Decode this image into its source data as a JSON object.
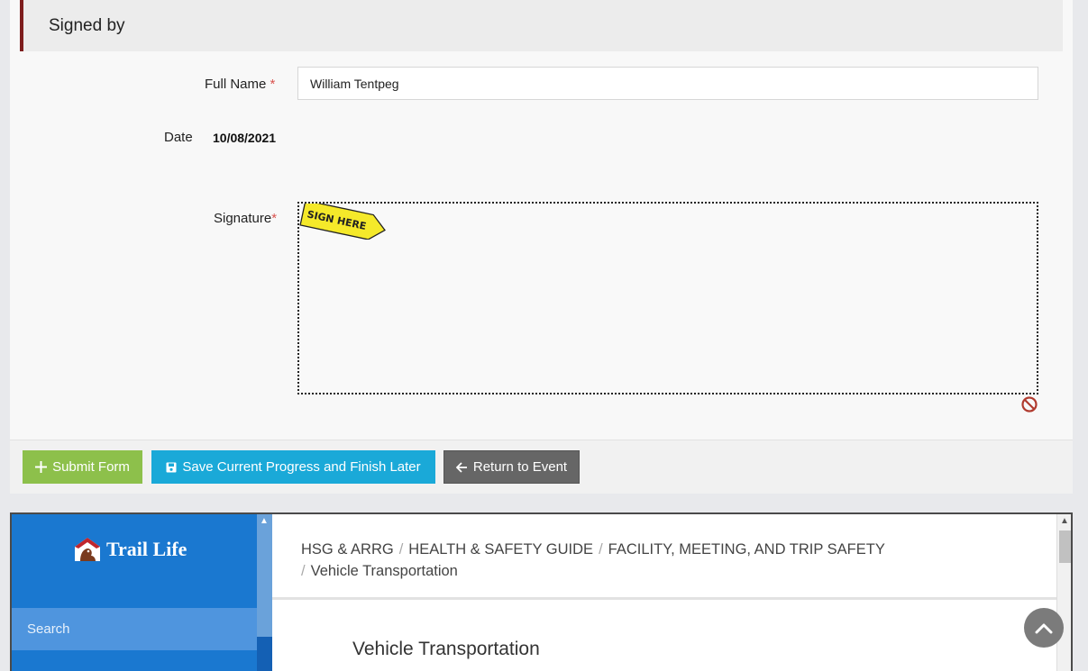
{
  "section": {
    "title": "Signed by"
  },
  "form": {
    "full_name_label": "Full Name",
    "required_mark": "*",
    "full_name_value": "William Tentpeg",
    "date_label": "Date",
    "date_value": "10/08/2021",
    "signature_label": "Signature",
    "sign_here_text": "SIGN HERE",
    "clear_icon": "no-entry-icon"
  },
  "buttons": {
    "submit_label": "Submit Form",
    "save_label": "Save Current Progress and Finish Later",
    "return_label": "Return to Event"
  },
  "embedded": {
    "logo_text": "Trail Life",
    "search_placeholder": "Search",
    "breadcrumb": [
      "HSG & ARRG",
      "HEALTH & SAFETY GUIDE",
      "FACILITY, MEETING, AND TRIP SAFETY"
    ],
    "breadcrumb_current": "Vehicle Transportation",
    "separator": "/",
    "page_heading": "Vehicle Transportation"
  },
  "colors": {
    "submit": "#8dc04b",
    "save": "#1aa9d8",
    "return": "#666666",
    "sidebar": "#1a78d0",
    "header_accent": "#7d1d1d"
  }
}
